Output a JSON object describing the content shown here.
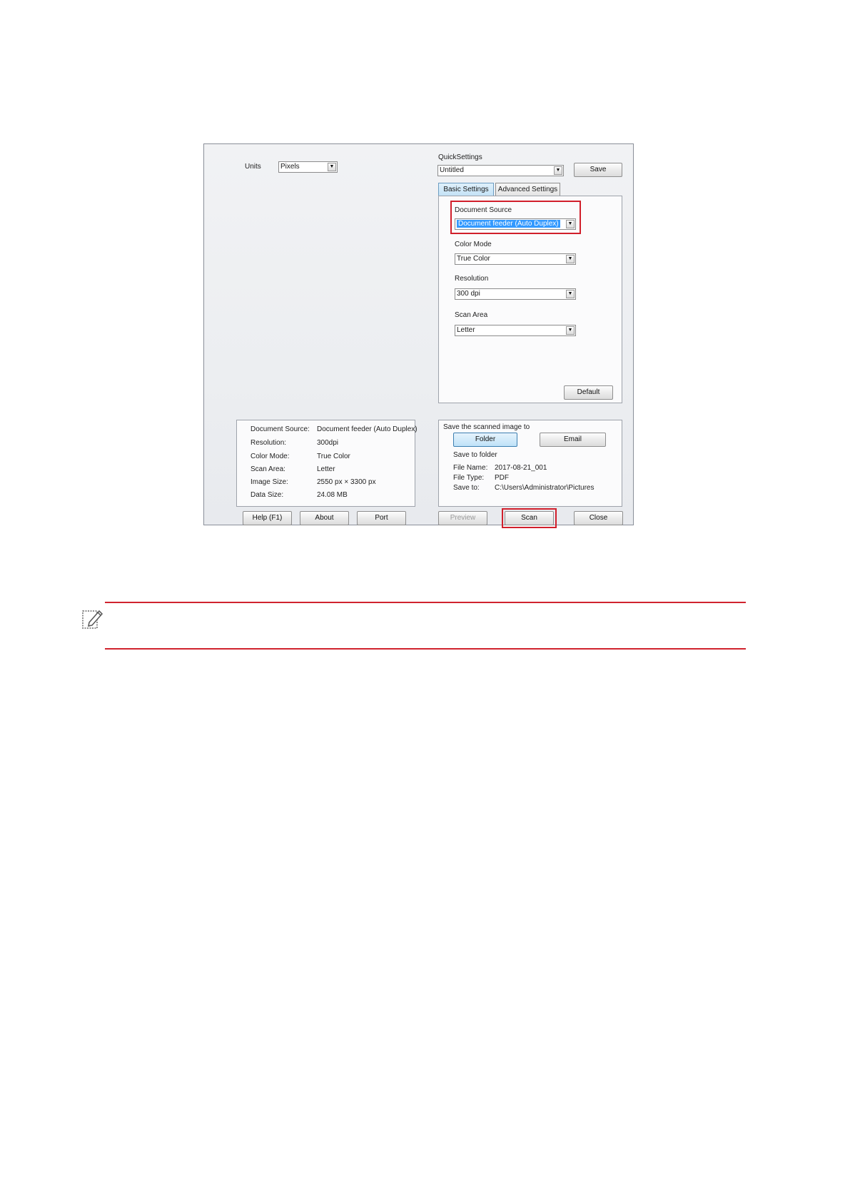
{
  "dialog": {
    "units": {
      "label": "Units",
      "value": "Pixels"
    },
    "quick_settings": {
      "label": "QuickSettings",
      "value": "Untitled",
      "save_button": "Save"
    },
    "tabs": [
      {
        "label": "Basic Settings"
      },
      {
        "label": "Advanced Settings"
      }
    ],
    "basic": {
      "document_source": {
        "label": "Document Source",
        "value": "Document feeder (Auto Duplex)"
      },
      "color_mode": {
        "label": "Color Mode",
        "value": "True Color"
      },
      "resolution": {
        "label": "Resolution",
        "value": "300 dpi"
      },
      "scan_area": {
        "label": "Scan Area",
        "value": "Letter"
      },
      "default_button": "Default"
    },
    "summary": [
      {
        "label": "Document Source:",
        "value": "Document feeder (Auto Duplex)"
      },
      {
        "label": "Resolution:",
        "value": "300dpi"
      },
      {
        "label": "Color Mode:",
        "value": "True Color"
      },
      {
        "label": "Scan Area:",
        "value": "Letter"
      },
      {
        "label": "Image Size:",
        "value": "2550 px × 3300 px"
      },
      {
        "label": "Data Size:",
        "value": "24.08 MB"
      }
    ],
    "save_to": {
      "title": "Save the scanned image to",
      "folder_button": "Folder",
      "email_button": "Email",
      "subtitle": "Save to folder",
      "fields": [
        {
          "label": "File Name:",
          "value": "2017-08-21_001"
        },
        {
          "label": "File Type:",
          "value": "PDF"
        },
        {
          "label": "Save to:",
          "value": "C:\\Users\\Administrator\\Pictures"
        }
      ]
    },
    "buttons": {
      "help": "Help (F1)",
      "about": "About",
      "port": "Port",
      "preview": "Preview",
      "scan": "Scan",
      "close": "Close"
    }
  },
  "note": {
    "icon": "note-pencil-icon"
  },
  "colors": {
    "highlight": "#d11f2b",
    "rule": "#d0232e",
    "selection": "#3399ff"
  }
}
